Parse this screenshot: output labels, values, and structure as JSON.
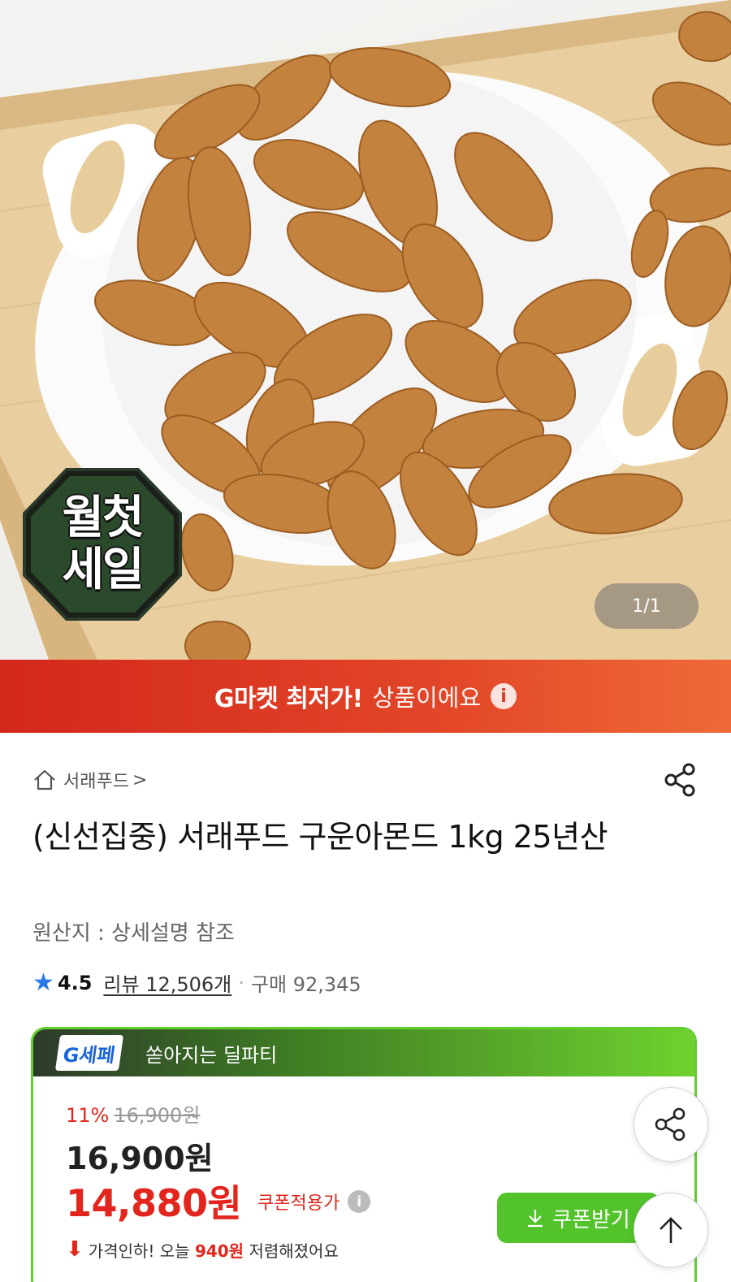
{
  "image": {
    "counter": "1/1"
  },
  "sale_badge": {
    "line1": "월첫",
    "line2": "세일"
  },
  "banner": {
    "bold": "G마켓 최저가!",
    "normal": "상품이에요",
    "info_glyph": "i"
  },
  "seller": {
    "name": "서래푸드",
    "chevron": ">"
  },
  "product": {
    "title": "(신선집중) 서래푸드 구운아몬드 1kg 25년산",
    "origin": "원산지 : 상세설명 참조",
    "rating": "4.5",
    "review_label": "리뷰 12,506개",
    "separator": "·",
    "purchase_label": "구매 92,345"
  },
  "deal": {
    "logo": "G세페",
    "header_text": "쏟아지는 딜파티",
    "discount_pct": "11%",
    "original_price": "16,900원",
    "price": "16,900원",
    "coupon_price": "14,880원",
    "coupon_label": "쿠폰적용가",
    "info_glyph": "i",
    "drop_prefix": "가격인하! 오늘",
    "drop_amount": "940원",
    "drop_suffix": "저렴해졌어요"
  },
  "buttons": {
    "coupon": "쿠폰받기"
  },
  "icons": [
    "home-icon",
    "share-icon",
    "star-icon",
    "info-icon",
    "download-icon",
    "arrow-up-icon"
  ],
  "colors": {
    "banner_red": "#d3271c",
    "deal_green": "#5fcf2c",
    "price_red": "#e3261d",
    "star_blue": "#2b7ce8"
  }
}
